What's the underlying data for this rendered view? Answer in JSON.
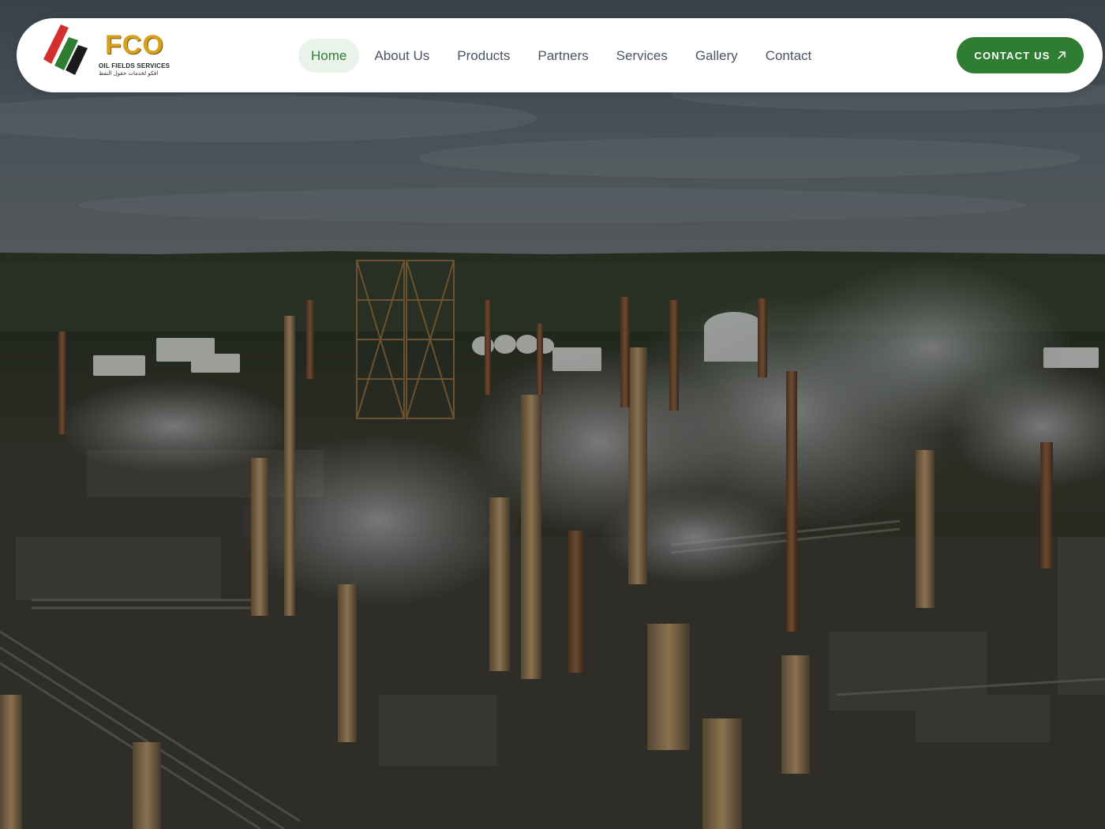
{
  "brand": {
    "logo_text": "FCO",
    "logo_subtitle": "OIL FIELDS SERVICES",
    "logo_arabic": "افكو لخدمات حقول النفط",
    "colors": {
      "red": "#d32f2f",
      "green": "#2e7d32",
      "black": "#1b1b1b",
      "gold": "#d6a21e"
    }
  },
  "nav": {
    "items": [
      {
        "label": "Home",
        "active": true
      },
      {
        "label": "About Us",
        "active": false
      },
      {
        "label": "Products",
        "active": false
      },
      {
        "label": "Partners",
        "active": false
      },
      {
        "label": "Services",
        "active": false
      },
      {
        "label": "Gallery",
        "active": false
      },
      {
        "label": "Contact",
        "active": false
      }
    ],
    "cta_label": "CONTACT US",
    "cta_icon": "arrow-up-right-icon",
    "accent": "#2e7d32"
  },
  "hero": {
    "image": "oil-refinery-aerial-background"
  }
}
